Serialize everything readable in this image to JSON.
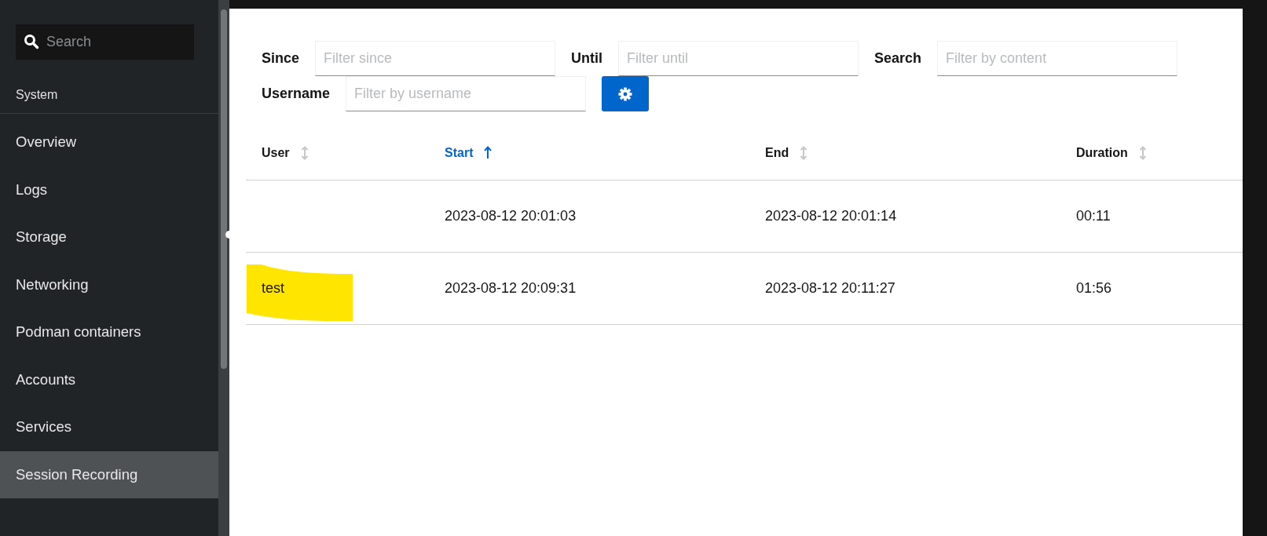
{
  "sidebar": {
    "search": {
      "placeholder": "Search"
    },
    "section": "System",
    "items": [
      {
        "label": "Overview",
        "selected": false
      },
      {
        "label": "Logs",
        "selected": false
      },
      {
        "label": "Storage",
        "selected": false
      },
      {
        "label": "Networking",
        "selected": false
      },
      {
        "label": "Podman containers",
        "selected": false
      },
      {
        "label": "Accounts",
        "selected": false
      },
      {
        "label": "Services",
        "selected": false
      },
      {
        "label": "Session Recording",
        "selected": true
      }
    ]
  },
  "filters": [
    {
      "label": "Since",
      "placeholder": "Filter since"
    },
    {
      "label": "Until",
      "placeholder": "Filter until"
    },
    {
      "label": "Search",
      "placeholder": "Filter by content"
    },
    {
      "label": "Username",
      "placeholder": "Filter by username"
    }
  ],
  "table": {
    "columns": [
      {
        "label": "User",
        "sorted": false
      },
      {
        "label": "Start",
        "sorted": true
      },
      {
        "label": "End",
        "sorted": false
      },
      {
        "label": "Duration",
        "sorted": false
      }
    ],
    "rows": [
      {
        "start": "2023-08-12 20:01:03",
        "end": "2023-08-12 20:01:14",
        "duration": "00:11",
        "highlighted": false
      },
      {
        "user": "test",
        "start": "2023-08-12 20:09:31",
        "end": "2023-08-12 20:11:27",
        "duration": "01:56",
        "highlighted": true
      }
    ]
  }
}
